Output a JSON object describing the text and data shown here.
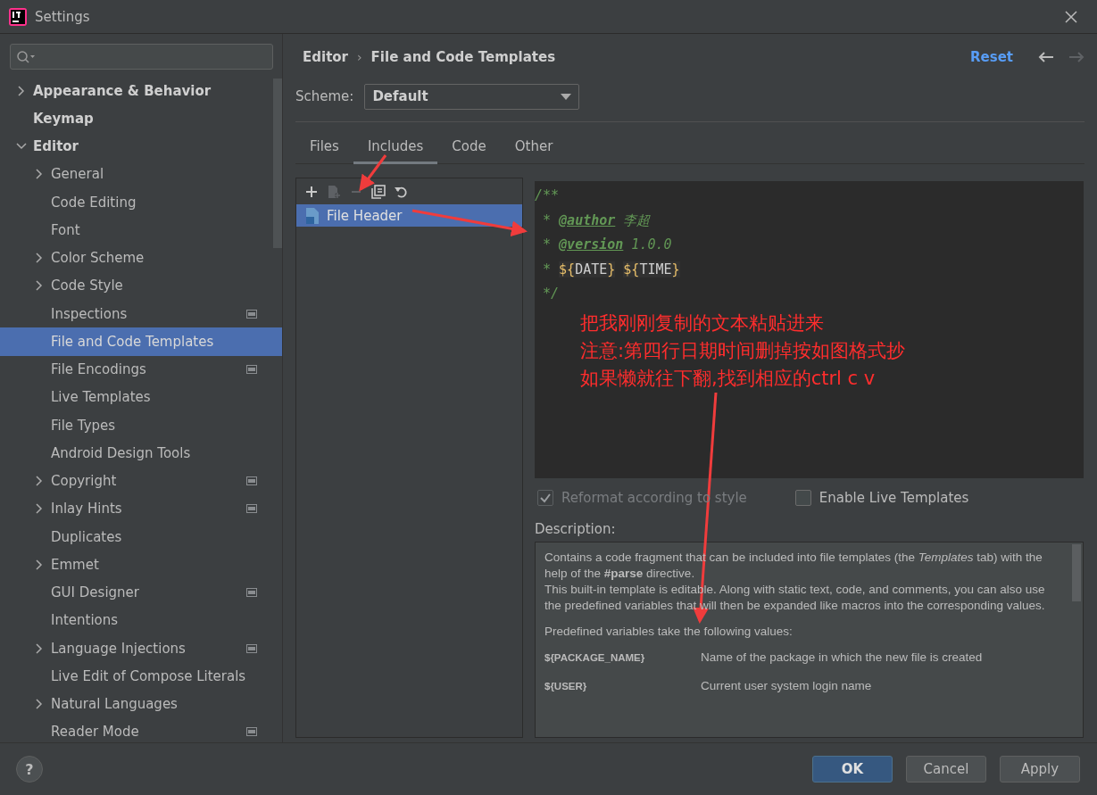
{
  "window": {
    "title": "Settings"
  },
  "sidebar": {
    "items": [
      {
        "label": "Appearance & Behavior",
        "kind": "folder",
        "expanded": false,
        "selected": false,
        "bold": true
      },
      {
        "label": "Keymap",
        "kind": "page",
        "selected": false,
        "bold": true
      },
      {
        "label": "Editor",
        "kind": "folder",
        "expanded": true,
        "selected": false,
        "bold": true,
        "children": [
          {
            "label": "General",
            "kind": "folder",
            "expanded": false,
            "selected": false,
            "project": false
          },
          {
            "label": "Code Editing",
            "kind": "page",
            "selected": false,
            "project": false
          },
          {
            "label": "Font",
            "kind": "page",
            "selected": false,
            "project": false
          },
          {
            "label": "Color Scheme",
            "kind": "folder",
            "expanded": false,
            "selected": false,
            "project": false
          },
          {
            "label": "Code Style",
            "kind": "folder",
            "expanded": false,
            "selected": false,
            "project": false
          },
          {
            "label": "Inspections",
            "kind": "page",
            "selected": false,
            "project": true
          },
          {
            "label": "File and Code Templates",
            "kind": "page",
            "selected": true,
            "project": false
          },
          {
            "label": "File Encodings",
            "kind": "page",
            "selected": false,
            "project": true
          },
          {
            "label": "Live Templates",
            "kind": "page",
            "selected": false,
            "project": false
          },
          {
            "label": "File Types",
            "kind": "page",
            "selected": false,
            "project": false
          },
          {
            "label": "Android Design Tools",
            "kind": "page",
            "selected": false,
            "project": false
          },
          {
            "label": "Copyright",
            "kind": "folder",
            "expanded": false,
            "selected": false,
            "project": true
          },
          {
            "label": "Inlay Hints",
            "kind": "folder",
            "expanded": false,
            "selected": false,
            "project": true
          },
          {
            "label": "Duplicates",
            "kind": "page",
            "selected": false,
            "project": false
          },
          {
            "label": "Emmet",
            "kind": "folder",
            "expanded": false,
            "selected": false,
            "project": false
          },
          {
            "label": "GUI Designer",
            "kind": "page",
            "selected": false,
            "project": true
          },
          {
            "label": "Intentions",
            "kind": "page",
            "selected": false,
            "project": false
          },
          {
            "label": "Language Injections",
            "kind": "folder",
            "expanded": false,
            "selected": false,
            "project": true
          },
          {
            "label": "Live Edit of Compose Literals",
            "kind": "page",
            "selected": false,
            "project": false
          },
          {
            "label": "Natural Languages",
            "kind": "folder",
            "expanded": false,
            "selected": false,
            "project": false
          },
          {
            "label": "Reader Mode",
            "kind": "page",
            "selected": false,
            "project": true
          }
        ]
      }
    ]
  },
  "header": {
    "breadcrumb": [
      "Editor",
      "File and Code Templates"
    ],
    "separator": "›",
    "reset": "Reset",
    "back_disabled": false,
    "forward_disabled": true
  },
  "scheme": {
    "label": "Scheme:",
    "value": "Default"
  },
  "tabs": [
    {
      "label": "Files",
      "selected": false
    },
    {
      "label": "Includes",
      "selected": true
    },
    {
      "label": "Code",
      "selected": false
    },
    {
      "label": "Other",
      "selected": false
    }
  ],
  "toolbar": [
    {
      "kind": "add",
      "disabled": false
    },
    {
      "kind": "add-file",
      "disabled": true
    },
    {
      "kind": "remove",
      "disabled": true
    },
    {
      "kind": "copy",
      "disabled": false
    },
    {
      "kind": "revert",
      "disabled": false
    }
  ],
  "templates": [
    {
      "label": "File Header",
      "selected": true
    }
  ],
  "editor": {
    "lines": [
      [
        {
          "kind": "comment",
          "text": "/**"
        }
      ],
      [
        {
          "kind": "comment",
          "text": " * "
        },
        {
          "kind": "tag",
          "text": "@author"
        },
        {
          "kind": "comment",
          "text": " 李超"
        }
      ],
      [
        {
          "kind": "comment",
          "text": " * "
        },
        {
          "kind": "tag",
          "text": "@version"
        },
        {
          "kind": "comment",
          "text": " 1.0.0"
        }
      ],
      [
        {
          "kind": "comment",
          "text": " * "
        },
        {
          "kind": "var",
          "open": "${",
          "name": "DATE",
          "close": "}"
        },
        {
          "kind": "var",
          "open": "${",
          "name": "TIME",
          "close": "}"
        }
      ],
      [
        {
          "kind": "comment",
          "text": " */"
        }
      ]
    ],
    "annotation": [
      "把我刚刚复制的文本粘贴进来",
      "注意:第四行日期时间删掉按如图格式抄",
      "如果懒就往下翻,找到相应的ctrl c v"
    ]
  },
  "options": [
    {
      "label": "Reformat according to style",
      "checked": true,
      "disabled": true
    },
    {
      "label": "Enable Live Templates",
      "checked": false,
      "disabled": false
    }
  ],
  "description": {
    "label": "Description:",
    "paragraphs": [
      "Contains a code fragment that can be included into file templates (the *Templates* tab) with the help of the **#parse** directive.\nThis built-in template is editable. Along with static text, code, and comments, you can also use the predefined variables that will then be expanded like macros into the corresponding values.",
      "Predefined variables take the following values:"
    ],
    "variables": [
      {
        "name": "${PACKAGE_NAME}",
        "meaning": "Name of the package in which the new file is created"
      },
      {
        "name": "${USER}",
        "meaning": "Current user system login name"
      }
    ]
  },
  "buttons": [
    {
      "label": "OK",
      "primary": true
    },
    {
      "label": "Cancel",
      "primary": false
    },
    {
      "label": "Apply",
      "primary": false
    }
  ],
  "help": "?"
}
